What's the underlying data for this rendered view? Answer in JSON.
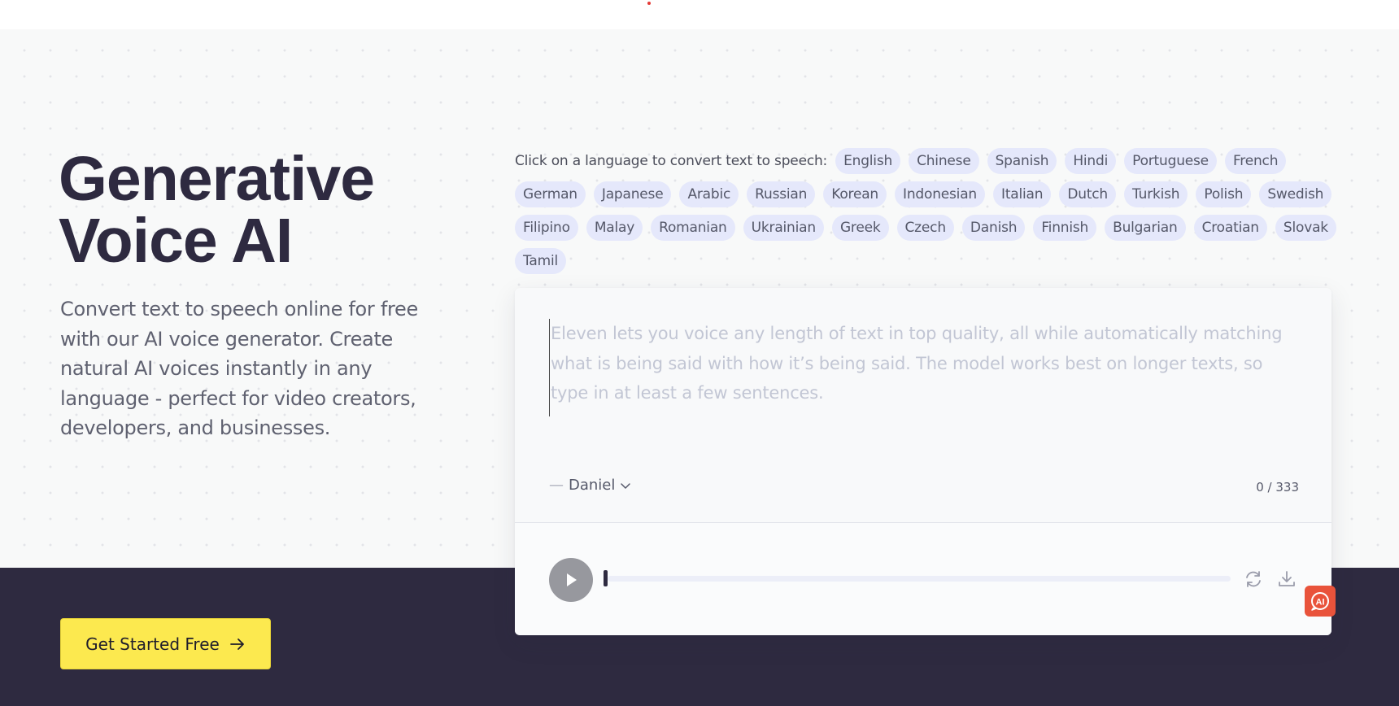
{
  "hero": {
    "headline_line1": "Generative",
    "headline_line2": "Voice AI",
    "subtext": "Convert text to speech online for free with our AI voice generator. Create natural AI voices instantly in any language - perfect for video creators, developers, and businesses.",
    "cta_label": "Get Started Free"
  },
  "languages": {
    "prompt": "Click on a language to convert text to speech:",
    "items": [
      "English",
      "Chinese",
      "Spanish",
      "Hindi",
      "Portuguese",
      "French",
      "German",
      "Japanese",
      "Arabic",
      "Russian",
      "Korean",
      "Indonesian",
      "Italian",
      "Dutch",
      "Turkish",
      "Polish",
      "Swedish",
      "Filipino",
      "Malay",
      "Romanian",
      "Ukrainian",
      "Greek",
      "Czech",
      "Danish",
      "Finnish",
      "Bulgarian",
      "Croatian",
      "Slovak",
      "Tamil"
    ]
  },
  "editor": {
    "placeholder": "Eleven lets you voice any length of text in top quality, all while automatically matching what is being said with how it’s being said. The model works best on longer texts, so type in at least a few sentences.",
    "voice_dash": "—",
    "voice_name": "Daniel",
    "char_count": "0 / 333"
  },
  "player": {
    "progress": 0
  },
  "icons": {
    "play": "play-icon",
    "refresh": "refresh-icon",
    "download": "download-icon",
    "chevron": "chevron-down-icon",
    "arrow": "arrow-right-icon",
    "ai_badge": "ai-chat-icon"
  },
  "colors": {
    "dark_band": "#2e2a40",
    "cta": "#fce94f",
    "chip": "#e5e8fb",
    "ai_badge": "#e9533b"
  }
}
